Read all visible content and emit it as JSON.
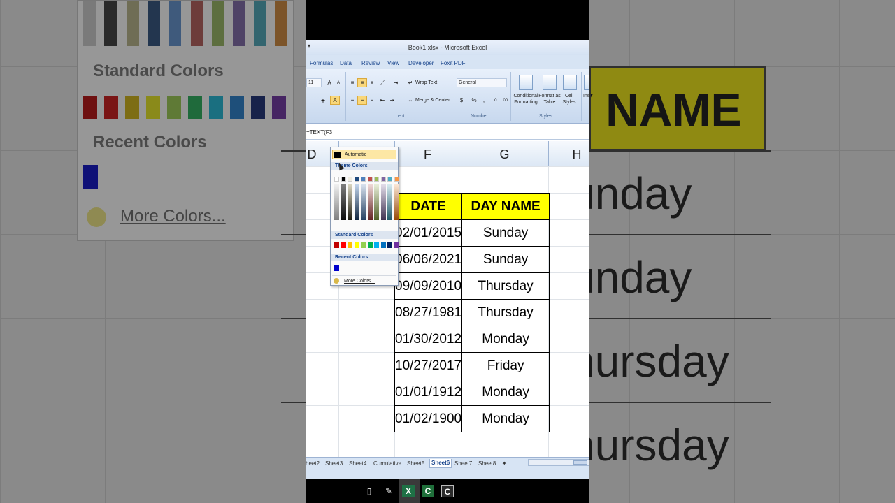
{
  "window": {
    "title": "Book1.xlsx - Microsoft Excel"
  },
  "ribbon_tabs": [
    "Formulas",
    "Data",
    "Review",
    "View",
    "Developer",
    "Foxit PDF"
  ],
  "ribbon": {
    "font_size": "11",
    "wrap_text": "Wrap Text",
    "merge_center": "Merge & Center",
    "number_format": "General",
    "currency_symbol": "$",
    "percent_symbol": "%",
    "comma_symbol": ",",
    "group_alignment_tail": "ent",
    "group_number": "Number",
    "group_styles": "Styles",
    "conditional_formatting": "Conditional Formatting",
    "format_as_table": "Format as Table",
    "cell_styles": "Cell Styles",
    "insert_partial": "Ins"
  },
  "formula": "=TEXT(F3",
  "columns": [
    "D",
    "F",
    "G",
    "H"
  ],
  "table": {
    "headers": [
      "DATE",
      "DAY NAME"
    ],
    "rows": [
      [
        "02/01/2015",
        "Sunday"
      ],
      [
        "06/06/2021",
        "Sunday"
      ],
      [
        "09/09/2010",
        "Thursday"
      ],
      [
        "08/27/1981",
        "Thursday"
      ],
      [
        "01/30/2012",
        "Monday"
      ],
      [
        "10/27/2017",
        "Friday"
      ],
      [
        "01/01/1912",
        "Monday"
      ],
      [
        "01/02/1900",
        "Monday"
      ]
    ]
  },
  "color_dropdown": {
    "automatic": "Automatic",
    "theme_colors_label": "Theme Colors",
    "standard_colors_label": "Standard Colors",
    "recent_colors_label": "Recent Colors",
    "more_colors": "More Colors...",
    "theme_top": [
      "#ffffff",
      "#000000",
      "#eeece1",
      "#1f497d",
      "#4f81bd",
      "#c0504d",
      "#9bbb59",
      "#8064a2",
      "#4bacc6",
      "#f79646"
    ],
    "standard": [
      "#c00000",
      "#ff0000",
      "#ffc000",
      "#ffff00",
      "#92d050",
      "#00b050",
      "#00b0f0",
      "#0070c0",
      "#002060",
      "#7030a0"
    ],
    "recent": [
      "#0000cc"
    ]
  },
  "sheet_tabs": [
    "heet2",
    "Sheet3",
    "Sheet4",
    "Cumulative",
    "Sheet5",
    "Sheet6",
    "Sheet7",
    "Sheet8"
  ],
  "active_sheet": "Sheet6",
  "background": {
    "standard_colors": "Standard Colors",
    "recent_colors": "Recent Colors",
    "more_colors": "More Colors...",
    "header": "Y NAME",
    "days": [
      "unday",
      "unday",
      "hursday",
      "hursday"
    ]
  }
}
